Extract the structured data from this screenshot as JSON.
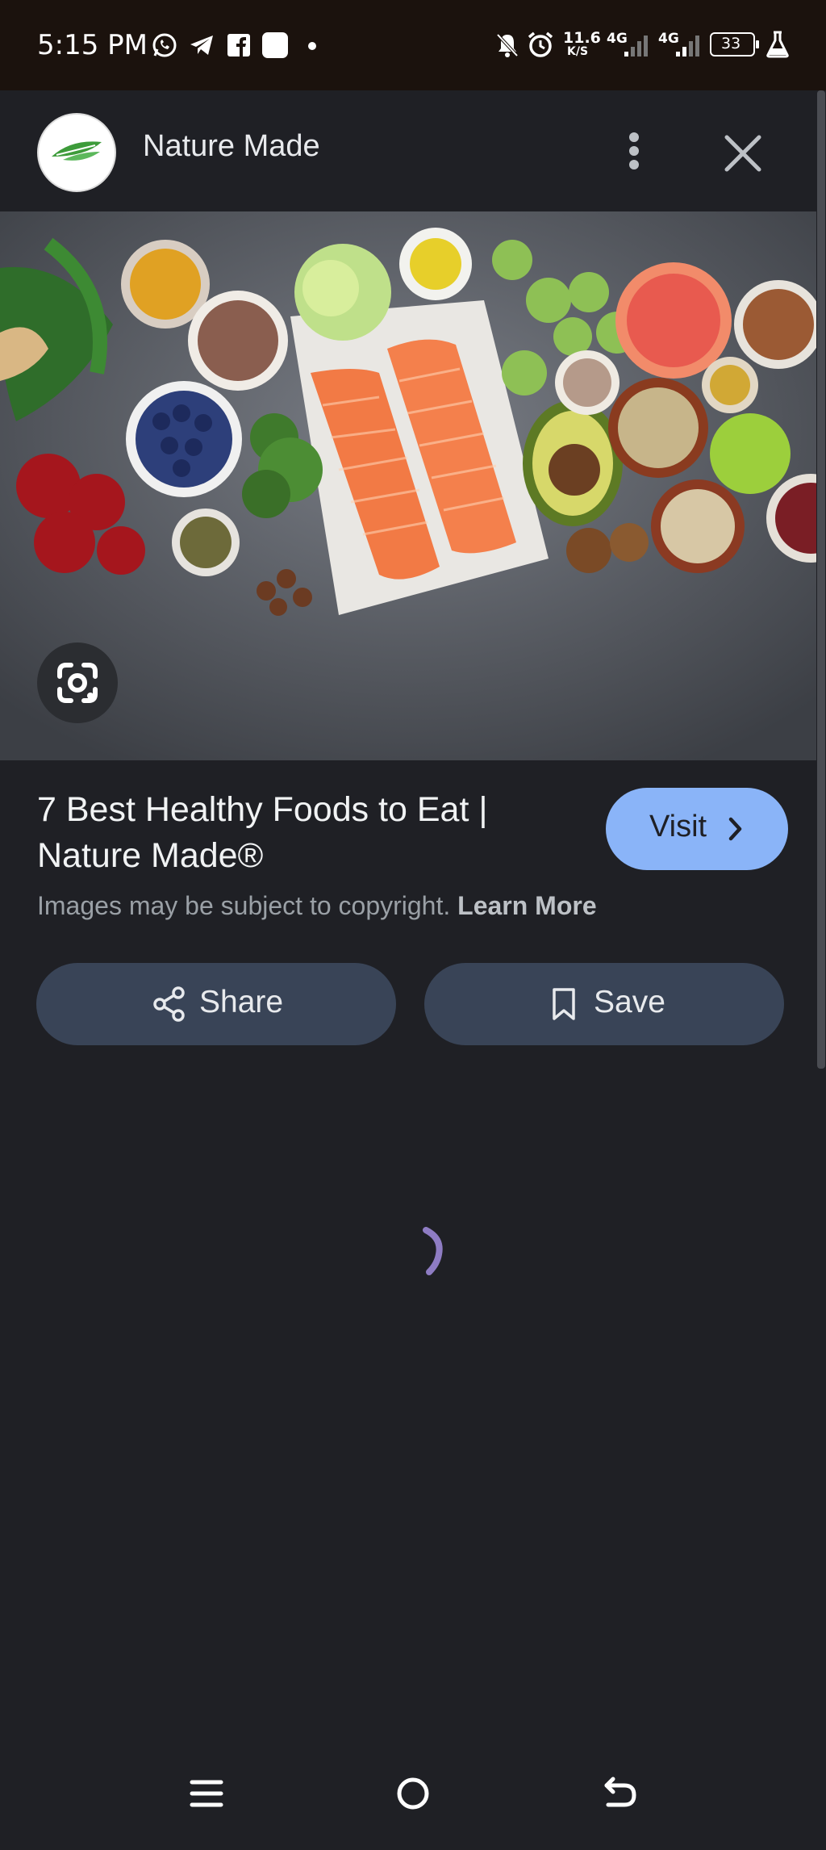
{
  "status_bar": {
    "time": "5:15 PM",
    "net_speed_value": "11.6",
    "net_speed_unit": "K/S",
    "network_1": "4G",
    "network_2": "4G",
    "battery": "33"
  },
  "header": {
    "site_name": "Nature Made"
  },
  "result": {
    "title": "7 Best Healthy Foods to Eat | Nature Made®",
    "visit_label": "Visit",
    "copyright_text": "Images may be subject to copyright.",
    "learn_more": "Learn More",
    "share_label": "Share",
    "save_label": "Save"
  },
  "colors": {
    "accent": "#8ab4f8",
    "button_bg": "#394457",
    "page_bg": "#1f2025",
    "spinner": "#8e7cc3"
  }
}
